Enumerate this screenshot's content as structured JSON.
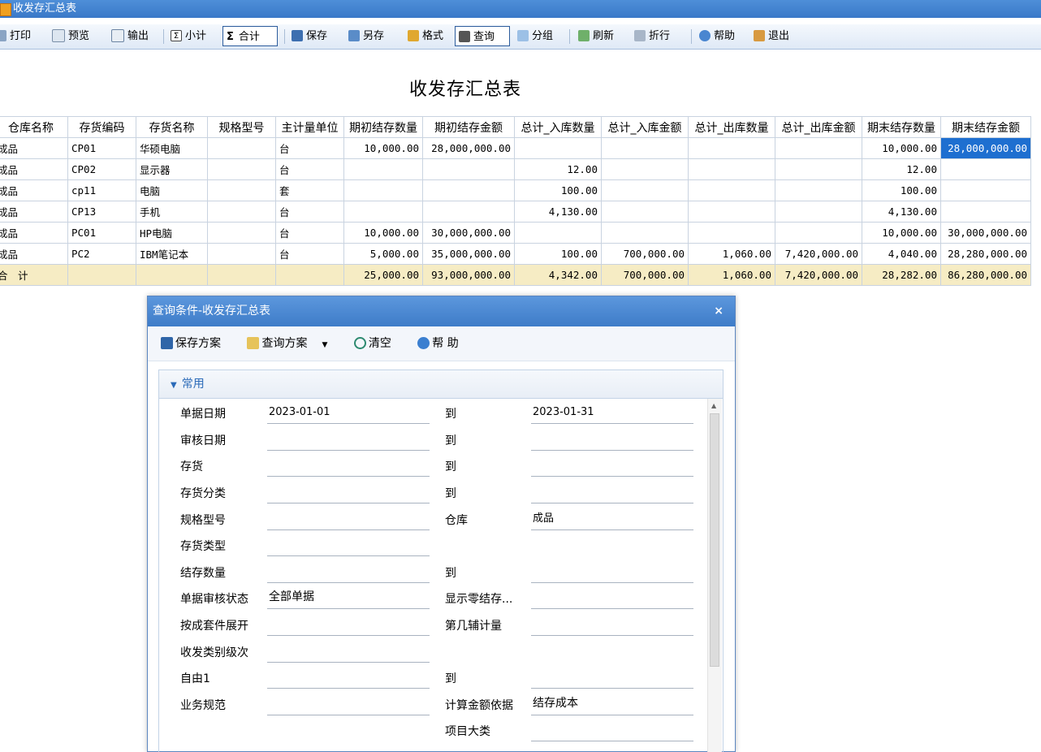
{
  "window": {
    "title": "收发存汇总表"
  },
  "toolbar": {
    "print": "打印",
    "preview": "预览",
    "export": "输出",
    "subtotal": "小计",
    "total": "合计",
    "save": "保存",
    "saveas": "另存",
    "format": "格式",
    "query": "查询",
    "group": "分组",
    "refresh": "刷新",
    "wrap": "折行",
    "help": "帮助",
    "exit": "退出",
    "sigma": "Σ",
    "sigma_box": "Σ"
  },
  "report": {
    "title": "收发存汇总表",
    "columns": [
      "仓库名称",
      "存货编码",
      "存货名称",
      "规格型号",
      "主计量单位",
      "期初结存数量",
      "期初结存金额",
      "总计_入库数量",
      "总计_入库金额",
      "总计_出库数量",
      "总计_出库金额",
      "期末结存数量",
      "期末结存金额"
    ],
    "rows": [
      [
        "成品",
        "CP01",
        "华硕电脑",
        "",
        "台",
        "10,000.00",
        "28,000,000.00",
        "",
        "",
        "",
        "",
        "10,000.00",
        "28,000,000.00"
      ],
      [
        "成品",
        "CP02",
        "显示器",
        "",
        "台",
        "",
        "",
        "12.00",
        "",
        "",
        "",
        "12.00",
        ""
      ],
      [
        "成品",
        "cp11",
        "电脑",
        "",
        "套",
        "",
        "",
        "100.00",
        "",
        "",
        "",
        "100.00",
        ""
      ],
      [
        "成品",
        "CP13",
        "手机",
        "",
        "台",
        "",
        "",
        "4,130.00",
        "",
        "",
        "",
        "4,130.00",
        ""
      ],
      [
        "成品",
        "PC01",
        "HP电脑",
        "",
        "台",
        "10,000.00",
        "30,000,000.00",
        "",
        "",
        "",
        "",
        "10,000.00",
        "30,000,000.00"
      ],
      [
        "成品",
        "PC2",
        "IBM笔记本",
        "",
        "台",
        "5,000.00",
        "35,000,000.00",
        "100.00",
        "700,000.00",
        "1,060.00",
        "7,420,000.00",
        "4,040.00",
        "28,280,000.00"
      ]
    ],
    "total_row": [
      "合　计",
      "",
      "",
      "",
      "",
      "25,000.00",
      "93,000,000.00",
      "4,342.00",
      "700,000.00",
      "1,060.00",
      "7,420,000.00",
      "28,282.00",
      "86,280,000.00"
    ]
  },
  "dialog": {
    "title": "查询条件-收发存汇总表",
    "close": "×",
    "tools": {
      "save_scheme": "保存方案",
      "query_scheme": "查询方案",
      "clear": "清空",
      "help": "帮 助"
    },
    "group_label": "常用",
    "fields": {
      "doc_date": {
        "label": "单据日期",
        "from": "2023-01-01",
        "to_label": "到",
        "to": "2023-01-31"
      },
      "audit_date": {
        "label": "审核日期",
        "from": "",
        "to_label": "到",
        "to": ""
      },
      "inventory": {
        "label": "存货",
        "from": "",
        "to_label": "到",
        "to": ""
      },
      "inv_class": {
        "label": "存货分类",
        "from": "",
        "to_label": "到",
        "to": ""
      },
      "spec": {
        "label": "规格型号",
        "value": "",
        "right_label": "仓库",
        "right_value": "成品"
      },
      "inv_type": {
        "label": "存货类型",
        "value": ""
      },
      "balance_qty": {
        "label": "结存数量",
        "from": "",
        "to_label": "到",
        "to": ""
      },
      "audit_status": {
        "label": "单据审核状态",
        "value": "全部单据",
        "right_label": "显示零结存...",
        "right_value": ""
      },
      "kit_expand": {
        "label": "按成套件展开",
        "value": "",
        "right_label": "第几辅计量",
        "right_value": ""
      },
      "rd_level": {
        "label": "收发类别级次",
        "value": ""
      },
      "free1": {
        "label": "自由1",
        "from": "",
        "to_label": "到",
        "to": ""
      },
      "biz_spec": {
        "label": "业务规范",
        "value": "",
        "right_label": "计算金额依据",
        "right_value": "结存成本"
      },
      "project_class": {
        "right_label": "项目大类",
        "right_value": ""
      }
    }
  },
  "colors": {
    "accent": "#3a78c8",
    "selected_cell": "#1e6fd0",
    "total_row": "#f6ecc4"
  }
}
